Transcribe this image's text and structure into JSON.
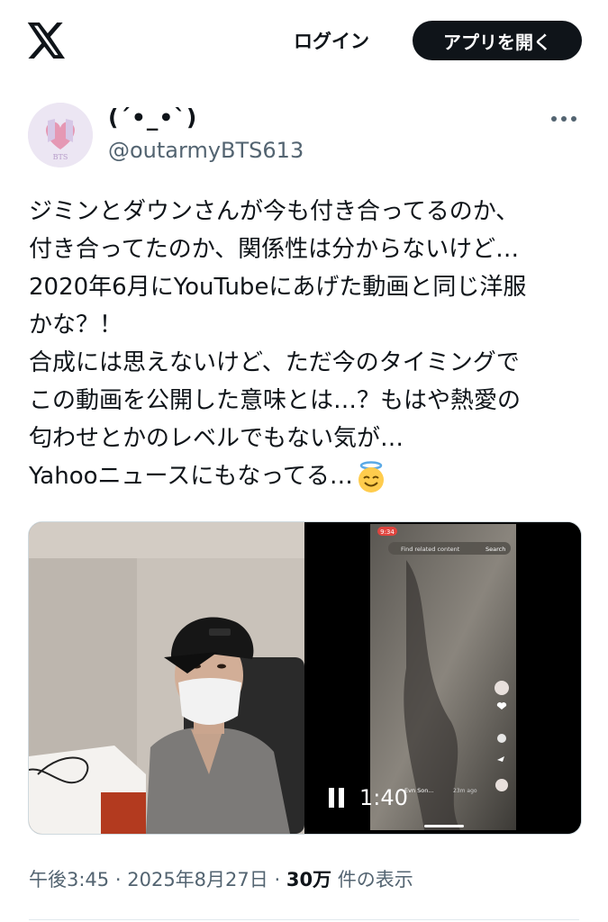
{
  "header": {
    "login_label": "ログイン",
    "open_app_label": "アプリを開く"
  },
  "author": {
    "display_name": "(´•_•`)",
    "handle": "@outarmyBTS613",
    "avatar_text": "BTS"
  },
  "tweet": {
    "lines": [
      "ジミンとダウンさんが今も付き合ってるのか、",
      "付き合ってたのか、関係性は分からないけど…",
      "2020年6月にYouTubeにあげた動画と同じ洋服",
      "かな？！",
      "合成には思えないけど、ただ今のタイミングで",
      "この動画を公開した意味とは…？もはや熱愛の",
      "匂わせとかのレベルでもない気が…",
      "Yahooニュースにもなってる…"
    ],
    "emoji": "smiling-face-with-halo"
  },
  "media": {
    "video_duration": "1:40",
    "phone_status_time": "9:34",
    "phone_search_placeholder": "Find related content",
    "phone_search_button": "Search",
    "phone_username": "Evn Son...",
    "phone_time_ago": "23m ago"
  },
  "meta": {
    "time": "午後3:45",
    "date": "2025年8月27日",
    "views": "30万",
    "views_suffix": "件の表示",
    "separator": "·"
  },
  "colors": {
    "text_primary": "#0f1419",
    "text_secondary": "#536471",
    "button_dark": "#0f1419"
  }
}
